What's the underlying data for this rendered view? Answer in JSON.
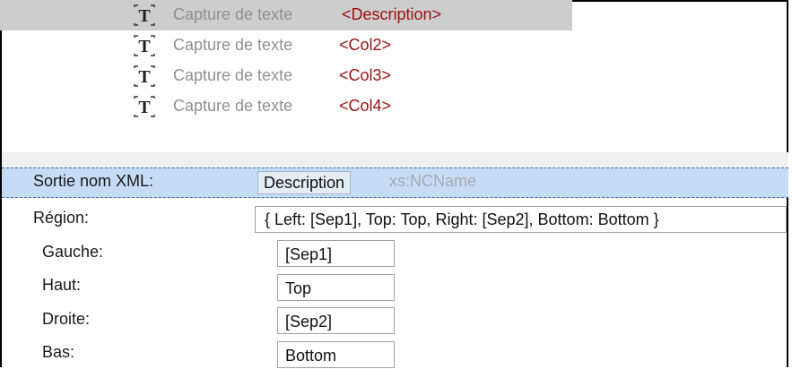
{
  "tree": {
    "rows": [
      {
        "caption": "Capture de texte",
        "tag": "<Description>",
        "icon": "text-capture-icon"
      },
      {
        "caption": "Capture de texte",
        "tag": "<Col2>",
        "icon": "text-capture-icon"
      },
      {
        "caption": "Capture de texte",
        "tag": "<Col3>",
        "icon": "text-capture-icon"
      },
      {
        "caption": "Capture de texte",
        "tag": "<Col4>",
        "icon": "text-capture-icon"
      }
    ]
  },
  "properties": {
    "output_name": {
      "label": "Sortie nom XML:",
      "value": "Description",
      "hint": "xs:NCName"
    },
    "region": {
      "label": "Région:",
      "value": "{ Left: [Sep1], Top: Top, Right: [Sep2], Bottom: Bottom }"
    },
    "left": {
      "label": "Gauche:",
      "value": "[Sep1]"
    },
    "top": {
      "label": "Haut:",
      "value": "Top"
    },
    "right": {
      "label": "Droite:",
      "value": "[Sep2]"
    },
    "bottom": {
      "label": "Bas:",
      "value": "Bottom"
    }
  },
  "colors": {
    "selection": "#cdcdcd",
    "highlight_row": "#c5dcf4",
    "tag_text": "#9a1010",
    "caption_text": "#909090"
  }
}
